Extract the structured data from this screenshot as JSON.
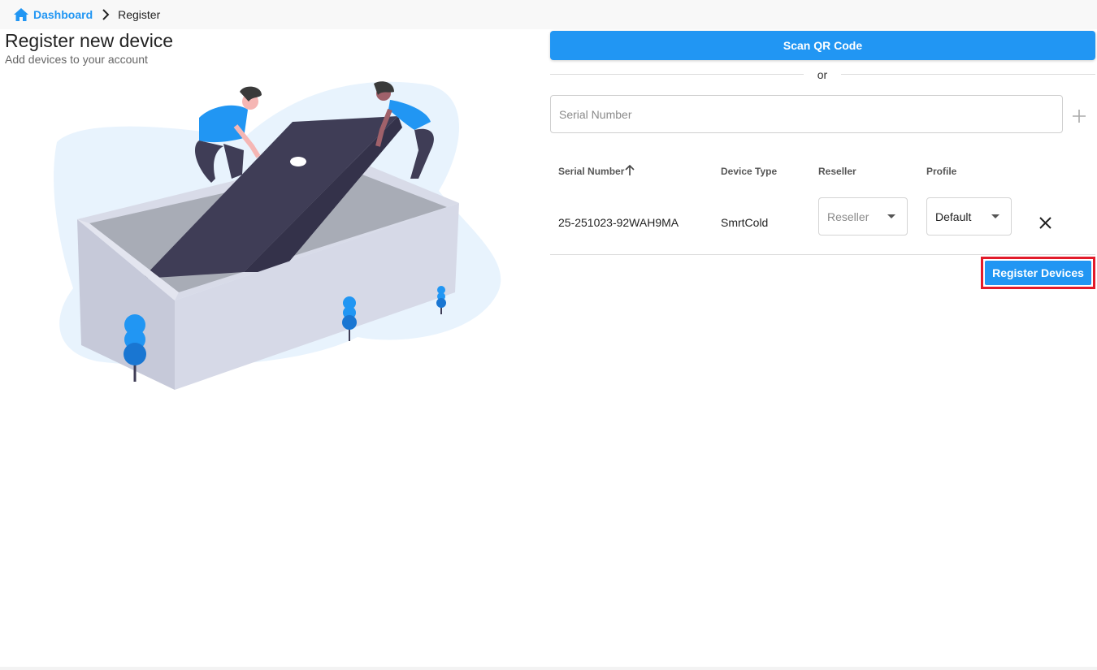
{
  "breadcrumb": {
    "home_icon": "home-icon",
    "dashboard_label": "Dashboard",
    "separator_icon": "chevron-right-icon",
    "current_label": "Register"
  },
  "header": {
    "title": "Register new device",
    "subtitle": "Add devices to your account"
  },
  "scan": {
    "button_label": "Scan QR Code",
    "or_label": "or"
  },
  "serial_input": {
    "placeholder": "Serial Number",
    "value": "",
    "add_icon": "plus-icon"
  },
  "table": {
    "columns": [
      "Serial Number",
      "Device Type",
      "Reseller",
      "Profile"
    ],
    "sort_icon": "arrow-up-icon",
    "rows": [
      {
        "serial_number": "25-251023-92WAH9MA",
        "device_type": "SmrtCold",
        "reseller_placeholder": "Reseller",
        "profile_value": "Default",
        "remove_icon": "close-icon"
      }
    ]
  },
  "actions": {
    "register_label": "Register Devices"
  },
  "colors": {
    "accent": "#2196f3",
    "highlight": "#e21b2a",
    "illustration_dark": "#3f3d56"
  }
}
